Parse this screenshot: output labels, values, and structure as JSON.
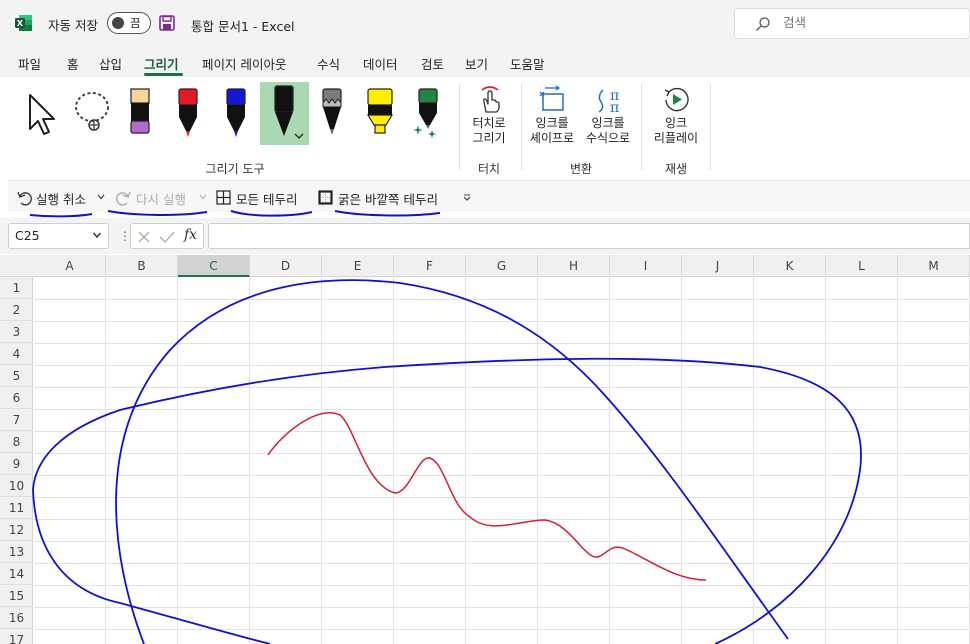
{
  "titlebar": {
    "autosave_label": "자동 저장",
    "autosave_state": "끔",
    "doc_title": "통합 문서1  -  Excel",
    "search_placeholder": "검색"
  },
  "menu": {
    "tabs": [
      "파일",
      "홈",
      "삽입",
      "그리기",
      "페이지 레이아웃",
      "수식",
      "데이터",
      "검토",
      "보기",
      "도움말"
    ],
    "active": "그리기"
  },
  "ribbon": {
    "draw_tools_label": "그리기 도구",
    "touch": {
      "button": [
        "터치로",
        "그리기"
      ],
      "group": "터치"
    },
    "convert": {
      "ink_to_shape": [
        "잉크를",
        "셰이프로"
      ],
      "ink_to_math": [
        "잉크를",
        "수식으로"
      ],
      "group": "변환"
    },
    "replay": {
      "button": [
        "잉크",
        "리플레이"
      ],
      "group": "재생"
    }
  },
  "quick_access": {
    "undo": "실행 취소",
    "redo": "다시 실행",
    "all_borders": "모든 테두리",
    "thick_box_border": "굵은 바깥쪽 테두리"
  },
  "formula_bar": {
    "name_box": "C25",
    "fx": "fx",
    "formula": ""
  },
  "sheet": {
    "columns": [
      "A",
      "B",
      "C",
      "D",
      "E",
      "F",
      "G",
      "H",
      "I",
      "J",
      "K",
      "L",
      "M"
    ],
    "selected_column": "C",
    "rows": [
      "1",
      "2",
      "3",
      "4",
      "5",
      "6",
      "7",
      "8",
      "9",
      "10",
      "11",
      "12",
      "13",
      "14",
      "15",
      "16",
      "17"
    ]
  },
  "colors": {
    "accent_green": "#217346",
    "ink_blue": "#1010d8",
    "ink_red": "#d42030"
  }
}
